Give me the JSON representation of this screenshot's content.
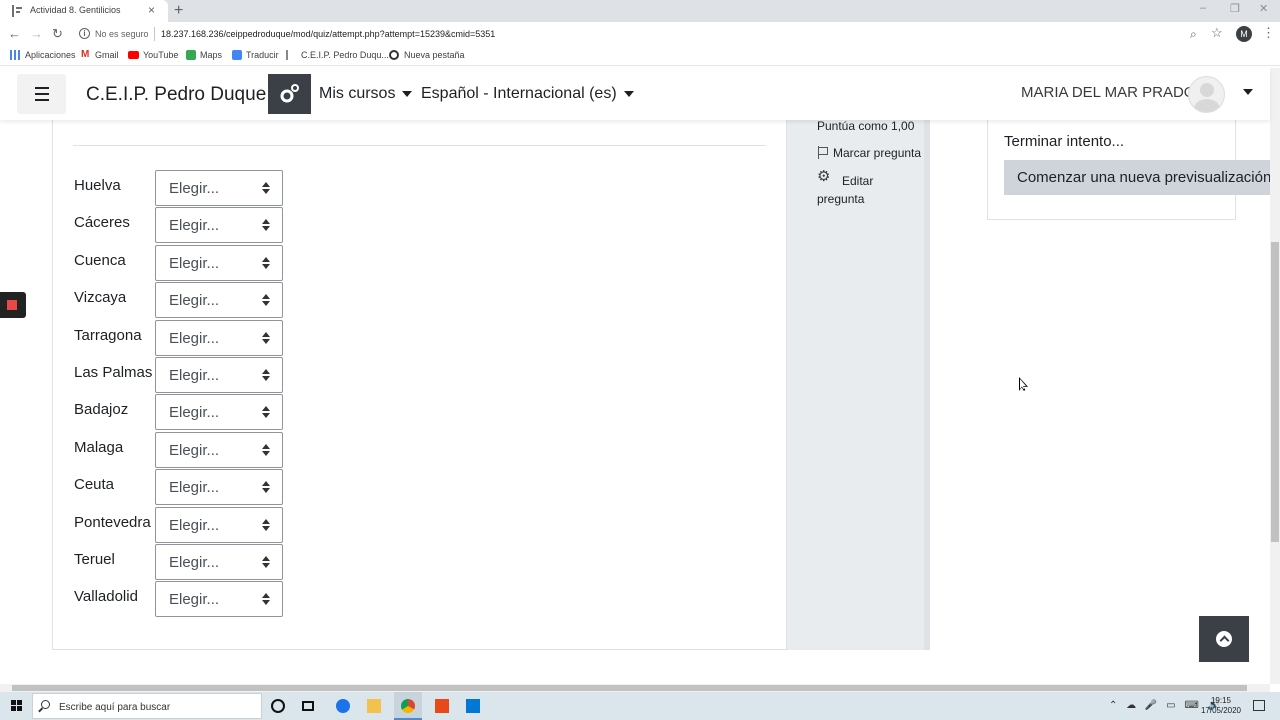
{
  "browser": {
    "tab_title": "Actividad 8. Gentilicios",
    "tab_close": "×",
    "new_tab": "+",
    "security_label": "No es seguro",
    "url": "18.237.168.236/ceippedroduque/mod/quiz/attempt.php?attempt=15239&cmid=5351",
    "profile_initial": "M",
    "bookmarks": [
      "Aplicaciones",
      "Gmail",
      "YouTube",
      "Maps",
      "Traducir",
      "C.E.I.P. Pedro Duqu...",
      "Nueva pestaña"
    ]
  },
  "navbar": {
    "site_name": "C.E.I.P. Pedro Duque",
    "my_courses": "Mis cursos",
    "language": "Español - Internacional (es)",
    "user_name": "MARIA DEL MAR PRADO"
  },
  "question": {
    "select_placeholder": "Elegir...",
    "rows": [
      {
        "label": "Huelva"
      },
      {
        "label": "Cáceres"
      },
      {
        "label": "Cuenca"
      },
      {
        "label": "Vizcaya"
      },
      {
        "label": "Tarragona"
      },
      {
        "label": "Las Palmas"
      },
      {
        "label": "Badajoz"
      },
      {
        "label": "Malaga"
      },
      {
        "label": "Ceuta"
      },
      {
        "label": "Pontevedra"
      },
      {
        "label": "Teruel"
      },
      {
        "label": "Valladolid"
      }
    ]
  },
  "info": {
    "score": "Puntúa como 1,00",
    "flag": "Marcar pregunta",
    "edit": "Editar pregunta"
  },
  "quiz_nav": {
    "finish": "Terminar intento...",
    "new_preview": "Comenzar una nueva previsualización"
  },
  "taskbar": {
    "search_placeholder": "Escribe aquí para buscar",
    "time": "19:15",
    "date": "17/05/2020"
  },
  "colors": {
    "dark_button": "#3b4046",
    "info_panel": "#e9ecef",
    "taskbar": "#dbe5ec"
  }
}
